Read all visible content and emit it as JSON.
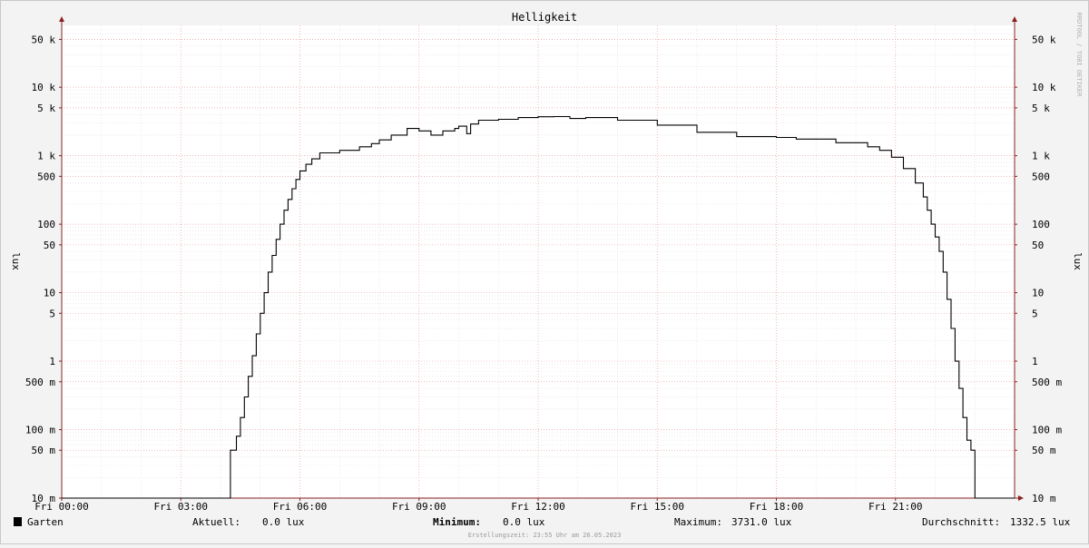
{
  "chart_data": {
    "type": "line",
    "title": "Helligkeit",
    "ylabel": "lux",
    "ylabel_right": "lux",
    "watermark": "RRDTOOL / TOBI OETIKER",
    "y_scale": "log",
    "ylim": [
      0.01,
      80000
    ],
    "xlim_hours": [
      0,
      24
    ],
    "x_ticks": [
      {
        "label": "Fri 00:00",
        "hour": 0
      },
      {
        "label": "Fri 03:00",
        "hour": 3
      },
      {
        "label": "Fri 06:00",
        "hour": 6
      },
      {
        "label": "Fri 09:00",
        "hour": 9
      },
      {
        "label": "Fri 12:00",
        "hour": 12
      },
      {
        "label": "Fri 15:00",
        "hour": 15
      },
      {
        "label": "Fri 18:00",
        "hour": 18
      },
      {
        "label": "Fri 21:00",
        "hour": 21
      }
    ],
    "y_ticks": [
      {
        "label": "10 m",
        "value": 0.01
      },
      {
        "label": "50 m",
        "value": 0.05
      },
      {
        "label": "100 m",
        "value": 0.1
      },
      {
        "label": "500 m",
        "value": 0.5
      },
      {
        "label": "1",
        "value": 1
      },
      {
        "label": "5",
        "value": 5
      },
      {
        "label": "10",
        "value": 10
      },
      {
        "label": "50",
        "value": 50
      },
      {
        "label": "100",
        "value": 100
      },
      {
        "label": "500",
        "value": 500
      },
      {
        "label": "1 k",
        "value": 1000
      },
      {
        "label": "5 k",
        "value": 5000
      },
      {
        "label": "10 k",
        "value": 10000
      },
      {
        "label": "50 k",
        "value": 50000
      }
    ],
    "grid": true,
    "series": [
      {
        "name": "Garten",
        "color": "#000000",
        "step": true,
        "points": [
          [
            0,
            0.01
          ],
          [
            4.2,
            0.01
          ],
          [
            4.25,
            0.05
          ],
          [
            4.4,
            0.08
          ],
          [
            4.5,
            0.15
          ],
          [
            4.6,
            0.3
          ],
          [
            4.7,
            0.6
          ],
          [
            4.8,
            1.2
          ],
          [
            4.9,
            2.5
          ],
          [
            5.0,
            5
          ],
          [
            5.1,
            10
          ],
          [
            5.2,
            20
          ],
          [
            5.3,
            35
          ],
          [
            5.4,
            60
          ],
          [
            5.5,
            100
          ],
          [
            5.6,
            160
          ],
          [
            5.7,
            230
          ],
          [
            5.8,
            330
          ],
          [
            5.9,
            450
          ],
          [
            6.0,
            600
          ],
          [
            6.15,
            750
          ],
          [
            6.3,
            900
          ],
          [
            6.5,
            1100
          ],
          [
            7.0,
            1200
          ],
          [
            7.5,
            1350
          ],
          [
            7.8,
            1500
          ],
          [
            8.0,
            1700
          ],
          [
            8.3,
            2000
          ],
          [
            8.7,
            2500
          ],
          [
            9.0,
            2300
          ],
          [
            9.3,
            2000
          ],
          [
            9.6,
            2300
          ],
          [
            9.9,
            2500
          ],
          [
            10.0,
            2700
          ],
          [
            10.2,
            2100
          ],
          [
            10.3,
            2900
          ],
          [
            10.5,
            3300
          ],
          [
            11.0,
            3400
          ],
          [
            11.5,
            3600
          ],
          [
            12.0,
            3700
          ],
          [
            12.4,
            3731
          ],
          [
            12.8,
            3500
          ],
          [
            13.2,
            3600
          ],
          [
            14.0,
            3300
          ],
          [
            15.0,
            2800
          ],
          [
            16.0,
            2200
          ],
          [
            17.0,
            1900
          ],
          [
            18.0,
            1850
          ],
          [
            18.5,
            1750
          ],
          [
            19.5,
            1550
          ],
          [
            20.3,
            1350
          ],
          [
            20.6,
            1200
          ],
          [
            20.9,
            950
          ],
          [
            21.2,
            650
          ],
          [
            21.5,
            400
          ],
          [
            21.7,
            250
          ],
          [
            21.8,
            160
          ],
          [
            21.9,
            100
          ],
          [
            22.0,
            65
          ],
          [
            22.1,
            40
          ],
          [
            22.2,
            20
          ],
          [
            22.3,
            8
          ],
          [
            22.4,
            3
          ],
          [
            22.5,
            1
          ],
          [
            22.6,
            0.4
          ],
          [
            22.7,
            0.15
          ],
          [
            22.8,
            0.07
          ],
          [
            22.9,
            0.05
          ],
          [
            23.0,
            0.01
          ],
          [
            24.0,
            0.01
          ]
        ]
      }
    ]
  },
  "legend": {
    "series_name": "Garten",
    "swatch_color": "#000000"
  },
  "stats": {
    "current_label": "Aktuell:",
    "current_value": "0.0 lux",
    "min_label": "Minimum:",
    "min_value": "0.0 lux",
    "max_label": "Maximum:",
    "max_value": "3731.0 lux",
    "avg_label": "Durchschnitt:",
    "avg_value": "1332.5 lux"
  },
  "footer": "Erstellungszeit: 23:55 Uhr am 26.05.2023"
}
